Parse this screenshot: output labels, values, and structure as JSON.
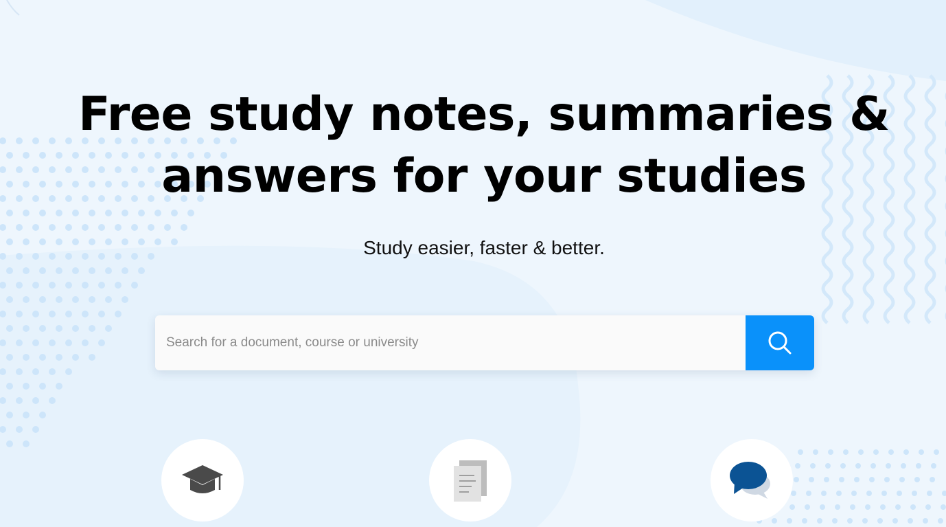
{
  "hero": {
    "title_line1": "Free study notes, summaries &",
    "title_line2": "answers for your studies",
    "subtitle": "Study easier, faster & better."
  },
  "search": {
    "placeholder": "Search for a document, course or university",
    "value": "",
    "button_icon": "search-icon"
  },
  "features": [
    {
      "icon": "graduation-cap-icon"
    },
    {
      "icon": "document-icon"
    },
    {
      "icon": "chat-bubble-icon"
    }
  ],
  "colors": {
    "accent": "#0a91fa",
    "background": "#eef6fd",
    "dots": "#cfe6fb",
    "chat_icon": "#0b5394",
    "cap_icon": "#4a4a4a",
    "document_icon": "#b8b8b8"
  }
}
